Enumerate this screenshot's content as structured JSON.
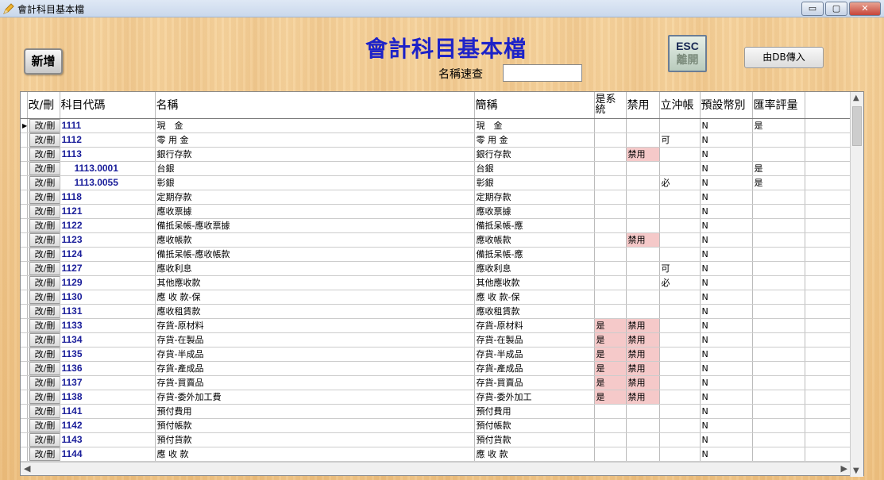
{
  "window": {
    "title": "會計科目基本檔",
    "min_glyph": "▭",
    "max_glyph": "▢",
    "close_glyph": "✕"
  },
  "toolbar": {
    "add_label": "新增",
    "page_title": "會計科目基本檔",
    "search_label": "名稱速查",
    "search_value": "",
    "esc_top": "ESC",
    "esc_bottom": "離開",
    "import_label": "由DB傳入"
  },
  "grid": {
    "headers": [
      "改/刪",
      "科目代碼",
      "名稱",
      "簡稱",
      "是系統",
      "禁用",
      "立沖帳",
      "預設幣別",
      "匯率評量"
    ],
    "edit_label": "改/刪",
    "rows": [
      {
        "code": "1111",
        "name": "現　金",
        "short": "現　金",
        "sys": "",
        "disabled": "",
        "offset": "",
        "currency": "N",
        "rate": "是",
        "sub": false
      },
      {
        "code": "1112",
        "name": "零 用 金",
        "short": "零 用 金",
        "sys": "",
        "disabled": "",
        "offset": "可",
        "currency": "N",
        "rate": "",
        "sub": false
      },
      {
        "code": "1113",
        "name": "銀行存款",
        "short": "銀行存款",
        "sys": "",
        "disabled": "禁用",
        "offset": "",
        "currency": "N",
        "rate": "",
        "sub": false
      },
      {
        "code": "1113.0001",
        "name": "台銀",
        "short": "台銀",
        "sys": "",
        "disabled": "",
        "offset": "",
        "currency": "N",
        "rate": "是",
        "sub": true
      },
      {
        "code": "1113.0055",
        "name": "彰銀",
        "short": "彰銀",
        "sys": "",
        "disabled": "",
        "offset": "必",
        "currency": "N",
        "rate": "是",
        "sub": true
      },
      {
        "code": "1118",
        "name": "定期存款",
        "short": "定期存款",
        "sys": "",
        "disabled": "",
        "offset": "",
        "currency": "N",
        "rate": "",
        "sub": false
      },
      {
        "code": "1121",
        "name": "應收票據",
        "short": "應收票據",
        "sys": "",
        "disabled": "",
        "offset": "",
        "currency": "N",
        "rate": "",
        "sub": false
      },
      {
        "code": "1122",
        "name": "備抵呆帳-應收票據",
        "short": "備抵呆帳-應",
        "sys": "",
        "disabled": "",
        "offset": "",
        "currency": "N",
        "rate": "",
        "sub": false
      },
      {
        "code": "1123",
        "name": "應收帳款",
        "short": "應收帳款",
        "sys": "",
        "disabled": "禁用",
        "offset": "",
        "currency": "N",
        "rate": "",
        "sub": false
      },
      {
        "code": "1124",
        "name": "備抵呆帳-應收帳款",
        "short": "備抵呆帳-應",
        "sys": "",
        "disabled": "",
        "offset": "",
        "currency": "N",
        "rate": "",
        "sub": false
      },
      {
        "code": "1127",
        "name": "應收利息",
        "short": "應收利息",
        "sys": "",
        "disabled": "",
        "offset": "可",
        "currency": "N",
        "rate": "",
        "sub": false
      },
      {
        "code": "1129",
        "name": "其他應收款",
        "short": "其他應收款",
        "sys": "",
        "disabled": "",
        "offset": "必",
        "currency": "N",
        "rate": "",
        "sub": false
      },
      {
        "code": "1130",
        "name": "應 收 款-保",
        "short": "應 收 款-保",
        "sys": "",
        "disabled": "",
        "offset": "",
        "currency": "N",
        "rate": "",
        "sub": false
      },
      {
        "code": "1131",
        "name": "應收租賃款",
        "short": "應收租賃款",
        "sys": "",
        "disabled": "",
        "offset": "",
        "currency": "N",
        "rate": "",
        "sub": false
      },
      {
        "code": "1133",
        "name": "存貨-原材料",
        "short": "存貨-原材料",
        "sys": "是",
        "disabled": "禁用",
        "offset": "",
        "currency": "N",
        "rate": "",
        "sub": false
      },
      {
        "code": "1134",
        "name": "存貨-在製品",
        "short": "存貨-在製品",
        "sys": "是",
        "disabled": "禁用",
        "offset": "",
        "currency": "N",
        "rate": "",
        "sub": false
      },
      {
        "code": "1135",
        "name": "存貨-半成品",
        "short": "存貨-半成品",
        "sys": "是",
        "disabled": "禁用",
        "offset": "",
        "currency": "N",
        "rate": "",
        "sub": false
      },
      {
        "code": "1136",
        "name": "存貨-產成品",
        "short": "存貨-產成品",
        "sys": "是",
        "disabled": "禁用",
        "offset": "",
        "currency": "N",
        "rate": "",
        "sub": false
      },
      {
        "code": "1137",
        "name": "存貨-買賣品",
        "short": "存貨-買賣品",
        "sys": "是",
        "disabled": "禁用",
        "offset": "",
        "currency": "N",
        "rate": "",
        "sub": false
      },
      {
        "code": "1138",
        "name": "存貨-委外加工費",
        "short": "存貨-委外加工",
        "sys": "是",
        "disabled": "禁用",
        "offset": "",
        "currency": "N",
        "rate": "",
        "sub": false
      },
      {
        "code": "1141",
        "name": "預付費用",
        "short": "預付費用",
        "sys": "",
        "disabled": "",
        "offset": "",
        "currency": "N",
        "rate": "",
        "sub": false
      },
      {
        "code": "1142",
        "name": "預付帳款",
        "short": "預付帳款",
        "sys": "",
        "disabled": "",
        "offset": "",
        "currency": "N",
        "rate": "",
        "sub": false
      },
      {
        "code": "1143",
        "name": "預付貨款",
        "short": "預付貨款",
        "sys": "",
        "disabled": "",
        "offset": "",
        "currency": "N",
        "rate": "",
        "sub": false
      },
      {
        "code": "1144",
        "name": "應 收 款",
        "short": "應 收 款",
        "sys": "",
        "disabled": "",
        "offset": "",
        "currency": "N",
        "rate": "",
        "sub": false
      }
    ],
    "current_row_marker": "▶"
  },
  "icons": {
    "app": "pencil-icon",
    "scroll_up": "▲",
    "scroll_down": "▼",
    "scroll_left": "◀",
    "scroll_right": "▶"
  }
}
